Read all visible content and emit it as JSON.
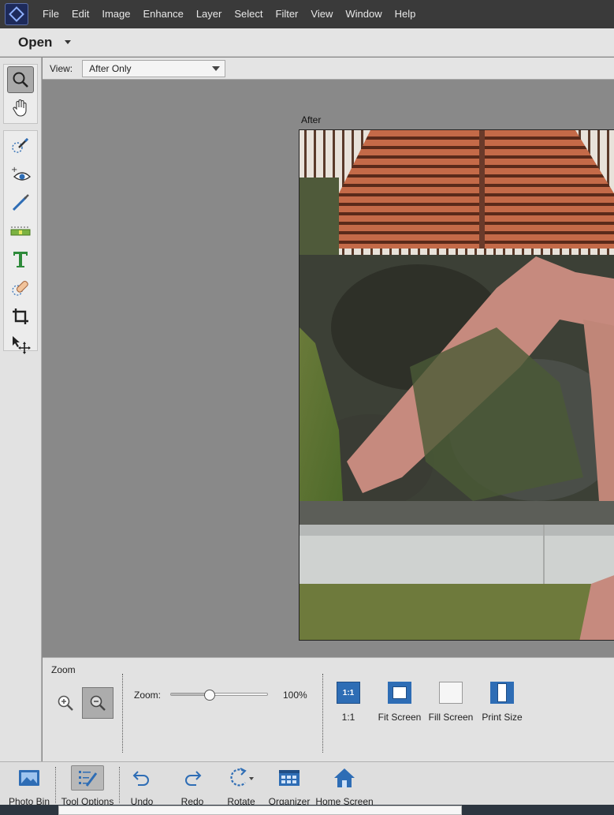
{
  "menubar": {
    "logo_icon": "elements-logo-icon",
    "items": [
      "File",
      "Edit",
      "Image",
      "Enhance",
      "Layer",
      "Select",
      "Filter",
      "View",
      "Window",
      "Help"
    ]
  },
  "mode": {
    "label": "Open"
  },
  "toolbar": {
    "tools": [
      "zoom-tool",
      "hand-tool",
      "quick-selection-tool",
      "red-eye-tool",
      "whiten-teeth-tool",
      "straighten-tool",
      "type-tool",
      "spot-healing-tool",
      "crop-tool",
      "move-tool"
    ],
    "active": "zoom-tool"
  },
  "viewbar": {
    "label": "View:",
    "selected": "After Only"
  },
  "canvas": {
    "after_label": "After"
  },
  "options": {
    "title": "Zoom",
    "zoom_label": "Zoom:",
    "zoom_value": "100%",
    "zoom_slider_fraction": 0.4,
    "active_zoom_button": "zoom-out",
    "buttons": {
      "one_to_one": "1:1",
      "one_to_one_icon_text": "1:1",
      "fit_screen": "Fit Screen",
      "fill_screen": "Fill Screen",
      "print_size": "Print Size"
    }
  },
  "taskbar": {
    "photo_bin": "Photo Bin",
    "tool_options": "Tool Options",
    "undo": "Undo",
    "redo": "Redo",
    "rotate": "Rotate",
    "organizer": "Organizer",
    "home_screen": "Home Screen",
    "active": "tool-options"
  },
  "colors": {
    "menubar": "#3a3a3a",
    "accent_blue": "#2e6db5",
    "canvas_bg": "#898989"
  }
}
